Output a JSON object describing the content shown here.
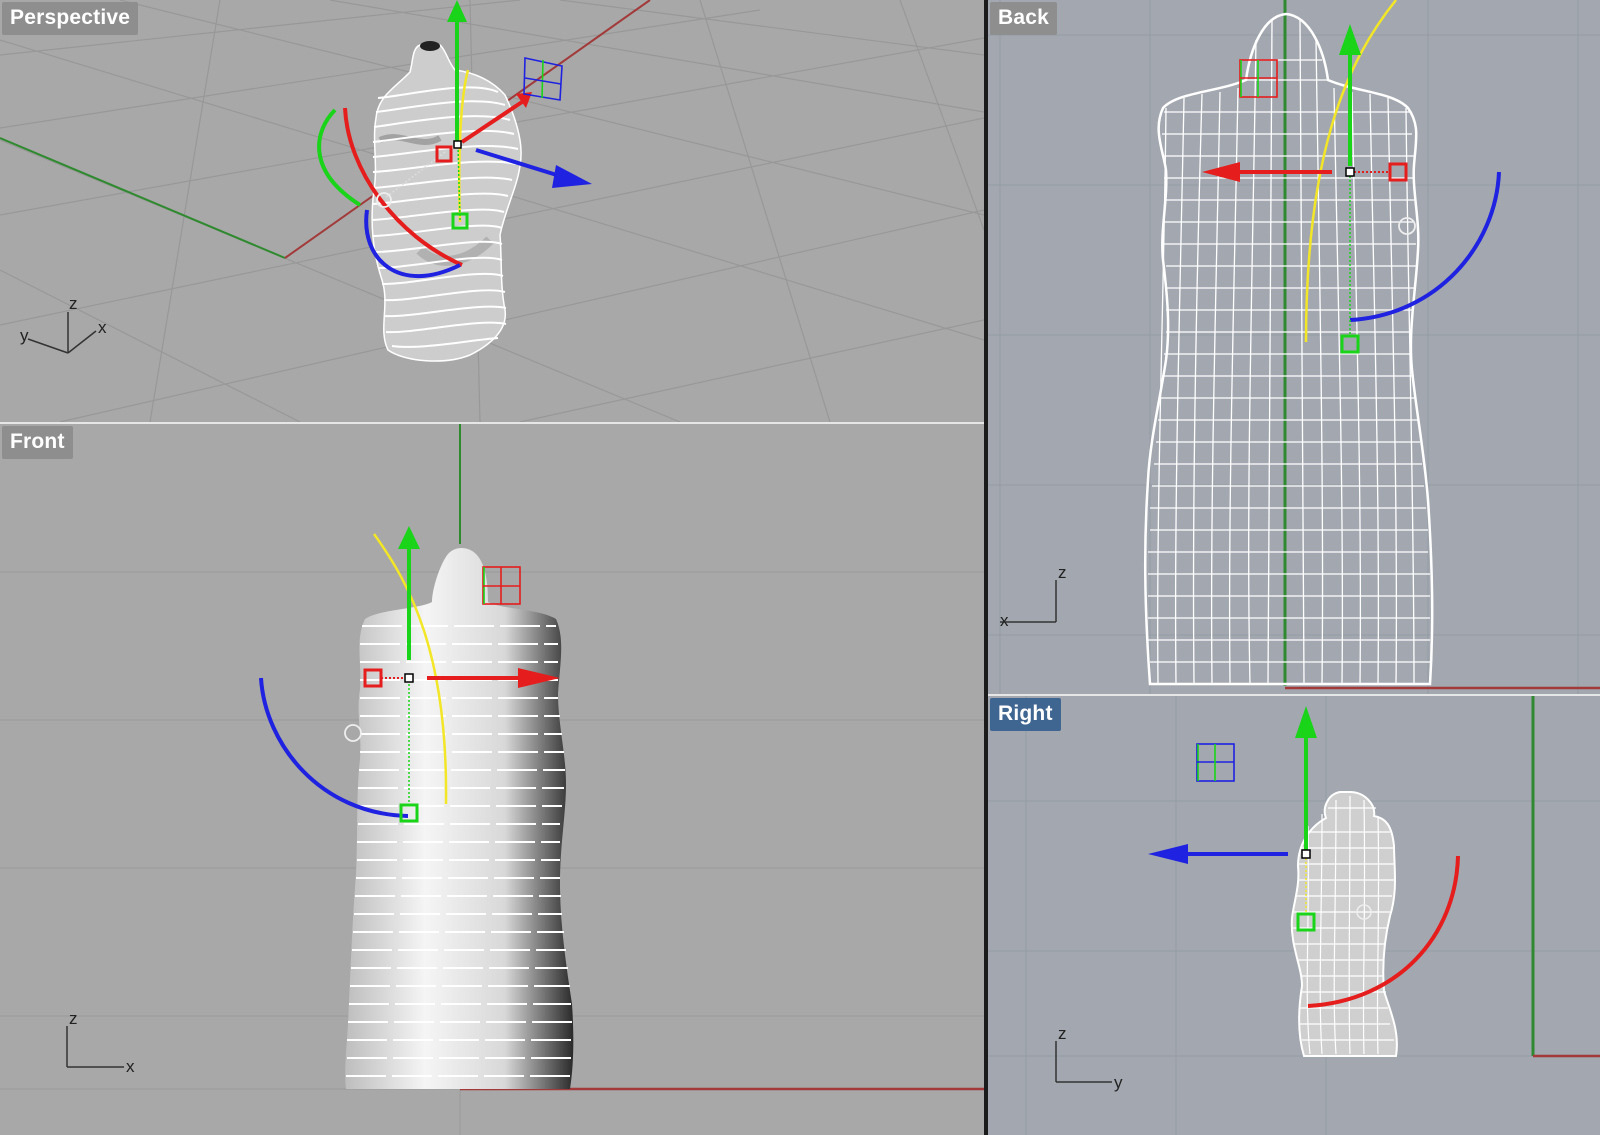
{
  "viewports": {
    "perspective": {
      "title": "Perspective",
      "active": false,
      "axes": [
        "z",
        "y",
        "x"
      ]
    },
    "front": {
      "title": "Front",
      "active": false,
      "axes": [
        "z",
        "x"
      ]
    },
    "back": {
      "title": "Back",
      "active": false,
      "axes": [
        "z",
        "x"
      ]
    },
    "right": {
      "title": "Right",
      "active": true,
      "axes": [
        "z",
        "y"
      ]
    }
  },
  "colors": {
    "viewport_bg_gray": "#a8a8a8",
    "viewport_bg_blue_gray": "#a3a8b0",
    "active_title_bg": "#3f6591",
    "inactive_title_bg": "#8e8e8e",
    "gumball_x": "#e51d1d",
    "gumball_y": "#19d419",
    "gumball_z": "#1f22e0",
    "curve_yellow": "#f2e627",
    "world_x_axis": "#a23a3a",
    "world_y_axis": "#2f8a2f"
  },
  "model": {
    "name": "mannequin torso",
    "icon": "torso-model"
  },
  "gumball": {
    "icon": "gumball-widget",
    "scale_handle_icon": "scale-box-icon"
  }
}
